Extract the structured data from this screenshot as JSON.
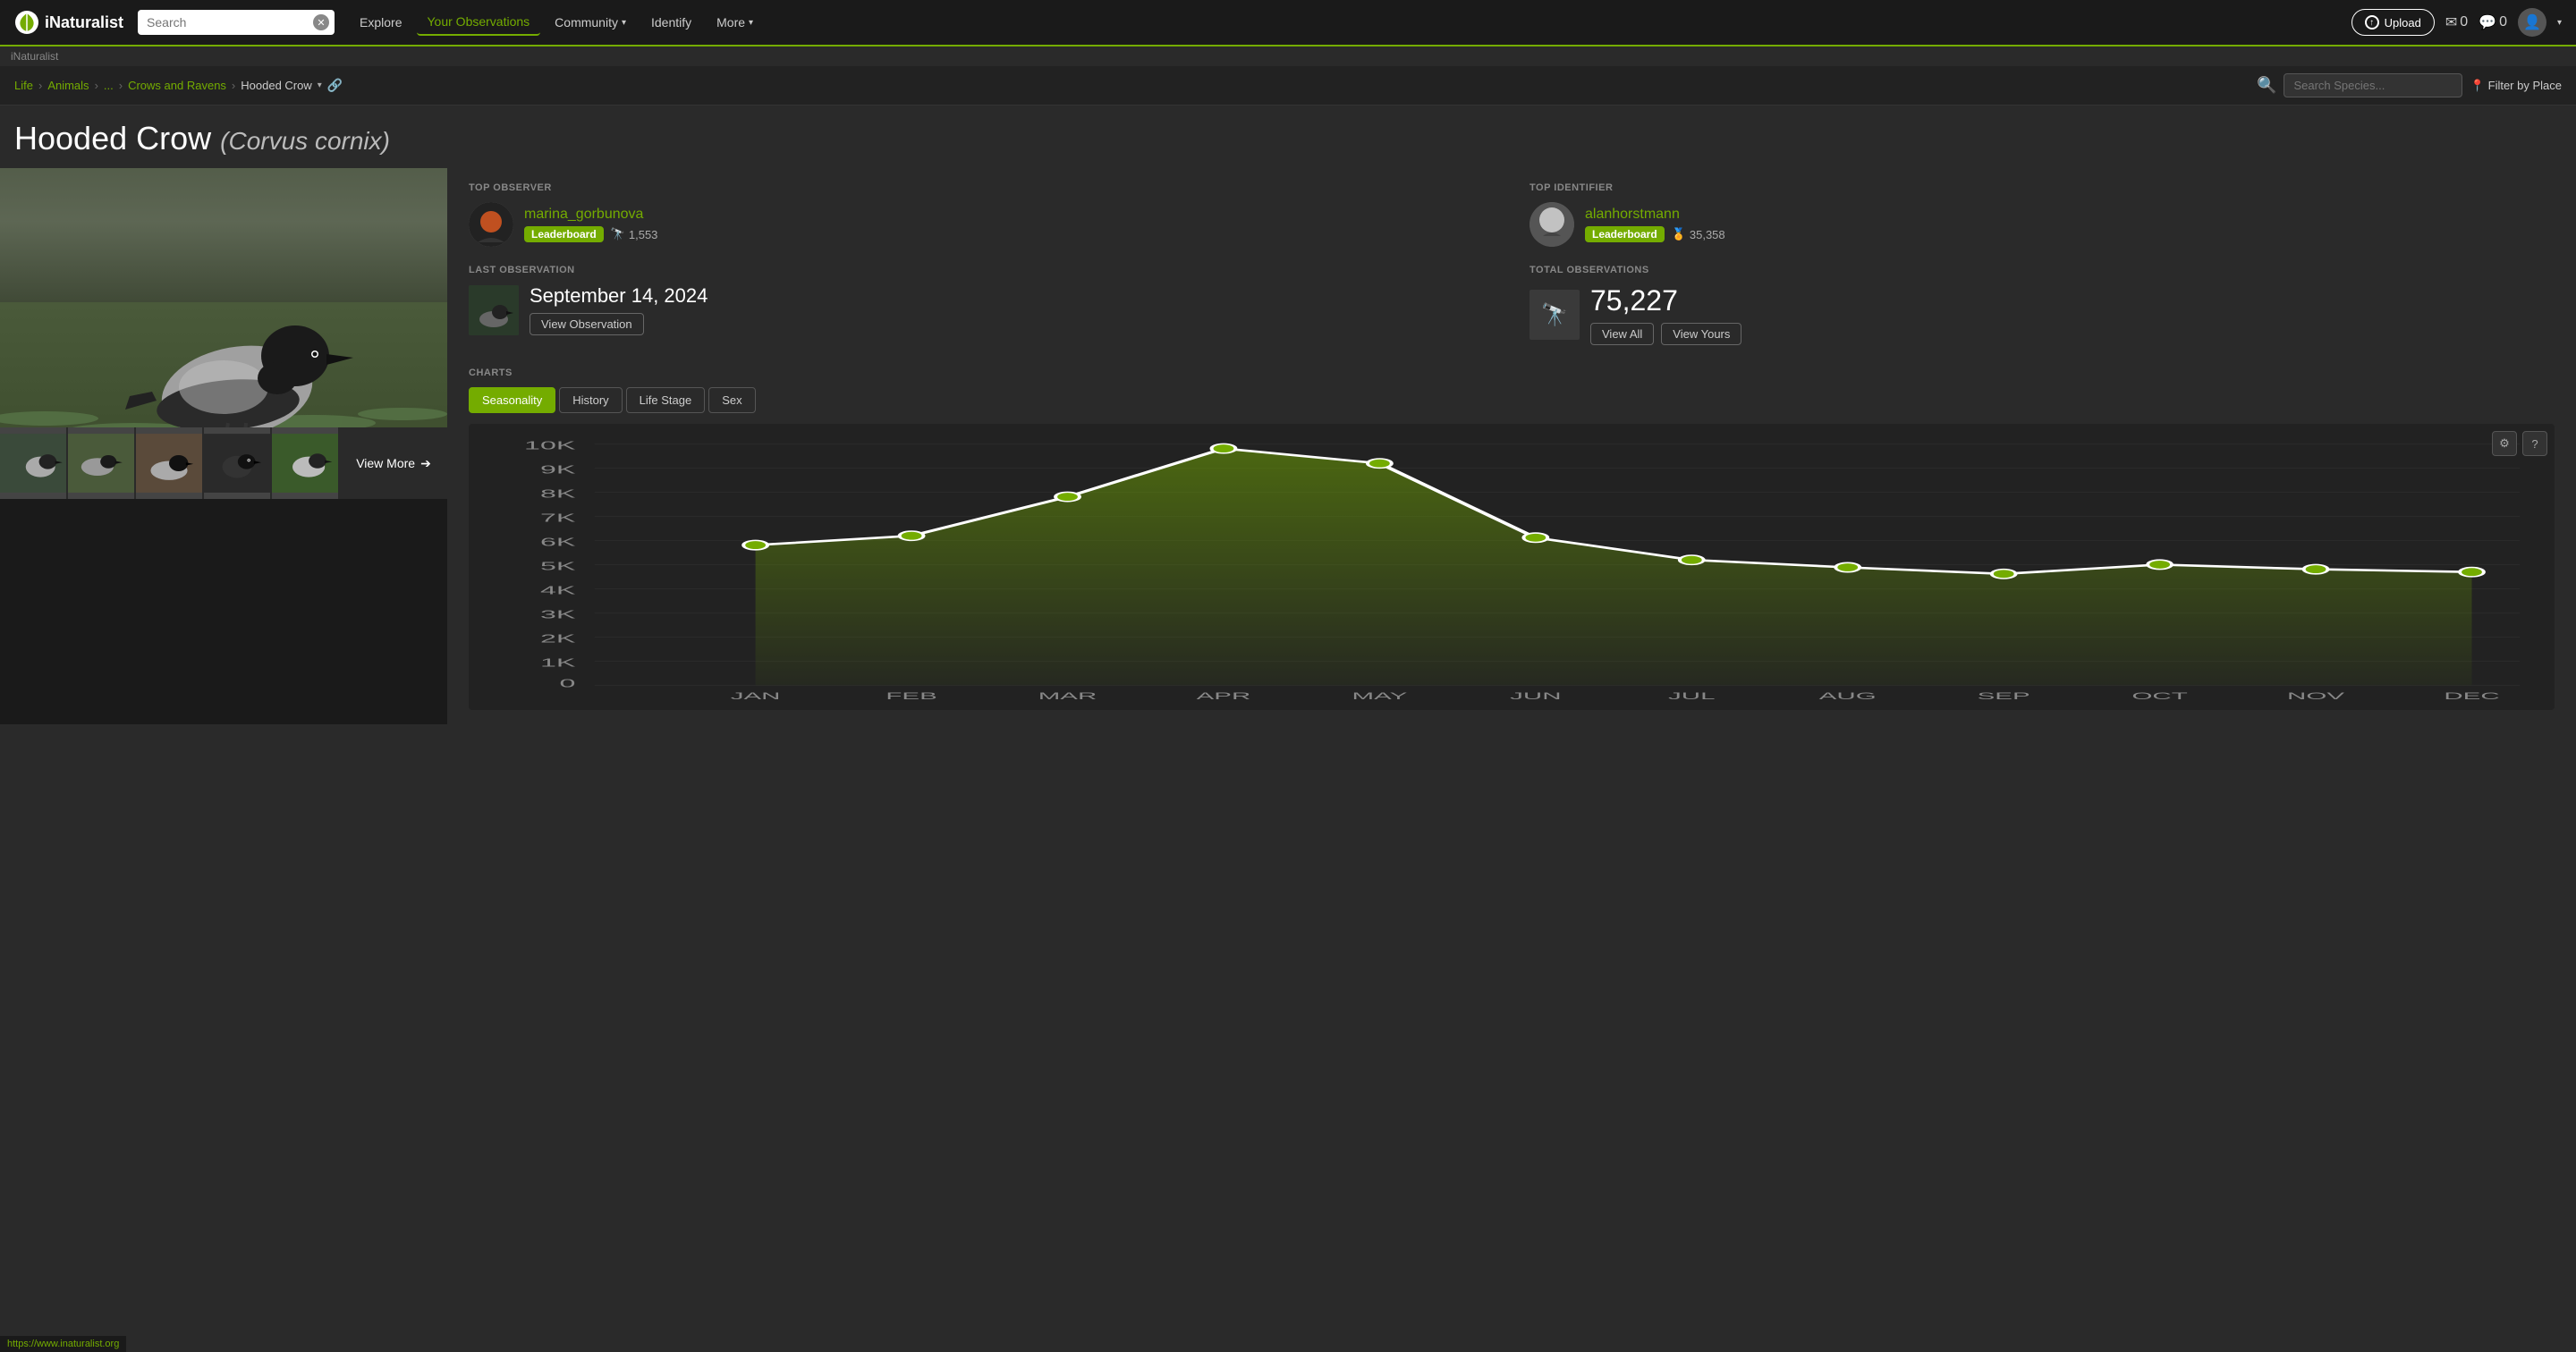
{
  "site": {
    "name": "iNaturalist",
    "url": "https://www.inaturalist.org"
  },
  "navbar": {
    "search_placeholder": "Search",
    "links": [
      {
        "label": "Explore",
        "id": "explore",
        "active": false
      },
      {
        "label": "Your Observations",
        "id": "your-observations",
        "active": false
      },
      {
        "label": "Community",
        "id": "community",
        "active": false,
        "has_dropdown": true
      },
      {
        "label": "Identify",
        "id": "identify",
        "active": false
      },
      {
        "label": "More",
        "id": "more",
        "active": false,
        "has_dropdown": true
      }
    ],
    "upload_label": "Upload",
    "mail_count": "0",
    "comment_count": "0"
  },
  "breadcrumb": {
    "inaturalist_label": "iNaturalist",
    "items": [
      {
        "label": "Life",
        "id": "life"
      },
      {
        "label": "Animals",
        "id": "animals"
      },
      {
        "label": "...",
        "id": "ellipsis"
      },
      {
        "label": "Crows and Ravens",
        "id": "crows-ravens"
      },
      {
        "label": "Hooded Crow",
        "id": "hooded-crow"
      }
    ]
  },
  "species": {
    "common_name": "Hooded Crow",
    "scientific_name": "Corvus cornix"
  },
  "search_species_placeholder": "Search Species...",
  "filter_place_label": "Filter by Place",
  "top_observer": {
    "label": "TOP OBSERVER",
    "name": "marina_gorbunova",
    "badge": "Leaderboard",
    "count": "1,553",
    "count_icon": "binoculars"
  },
  "top_identifier": {
    "label": "TOP IDENTIFIER",
    "name": "alanhorstmann",
    "badge": "Leaderboard",
    "count": "35,358",
    "count_icon": "identifier"
  },
  "last_observation": {
    "label": "LAST OBSERVATION",
    "date": "September 14, 2024",
    "view_btn": "View Observation"
  },
  "total_observations": {
    "label": "TOTAL OBSERVATIONS",
    "count": "75,227",
    "view_all_btn": "View All",
    "view_yours_btn": "View Yours"
  },
  "charts": {
    "label": "CHARTS",
    "tabs": [
      {
        "label": "Seasonality",
        "id": "seasonality",
        "active": true
      },
      {
        "label": "History",
        "id": "history",
        "active": false
      },
      {
        "label": "Life Stage",
        "id": "life-stage",
        "active": false
      },
      {
        "label": "Sex",
        "id": "sex",
        "active": false
      }
    ],
    "y_labels": [
      "10K",
      "9K",
      "8K",
      "7K",
      "6K",
      "5K",
      "4K",
      "3K",
      "2K",
      "1K",
      "0"
    ],
    "x_labels": [
      "JAN",
      "FEB",
      "MAR",
      "APR",
      "MAY",
      "JUN",
      "JUL",
      "AUG",
      "SEP",
      "OCT",
      "NOV",
      "DEC"
    ],
    "data_points": [
      {
        "month": "JAN",
        "value": 5800
      },
      {
        "month": "FEB",
        "value": 6200
      },
      {
        "month": "MAR",
        "value": 7800
      },
      {
        "month": "APR",
        "value": 9800
      },
      {
        "month": "MAY",
        "value": 9200
      },
      {
        "month": "JUN",
        "value": 6100
      },
      {
        "month": "JUL",
        "value": 5200
      },
      {
        "month": "AUG",
        "value": 4900
      },
      {
        "month": "SEP",
        "value": 4600
      },
      {
        "month": "OCT",
        "value": 5000
      },
      {
        "month": "NOV",
        "value": 4800
      },
      {
        "month": "DEC",
        "value": 4700
      }
    ],
    "max_value": 10000
  },
  "images": {
    "thumbnails": [
      "crow1",
      "crow2",
      "crow3",
      "crow4",
      "crow5"
    ],
    "view_more_label": "View More"
  },
  "controls": {
    "settings_icon": "⚙",
    "help_icon": "?"
  },
  "status_bar_url": "https://www.inaturalist.org"
}
